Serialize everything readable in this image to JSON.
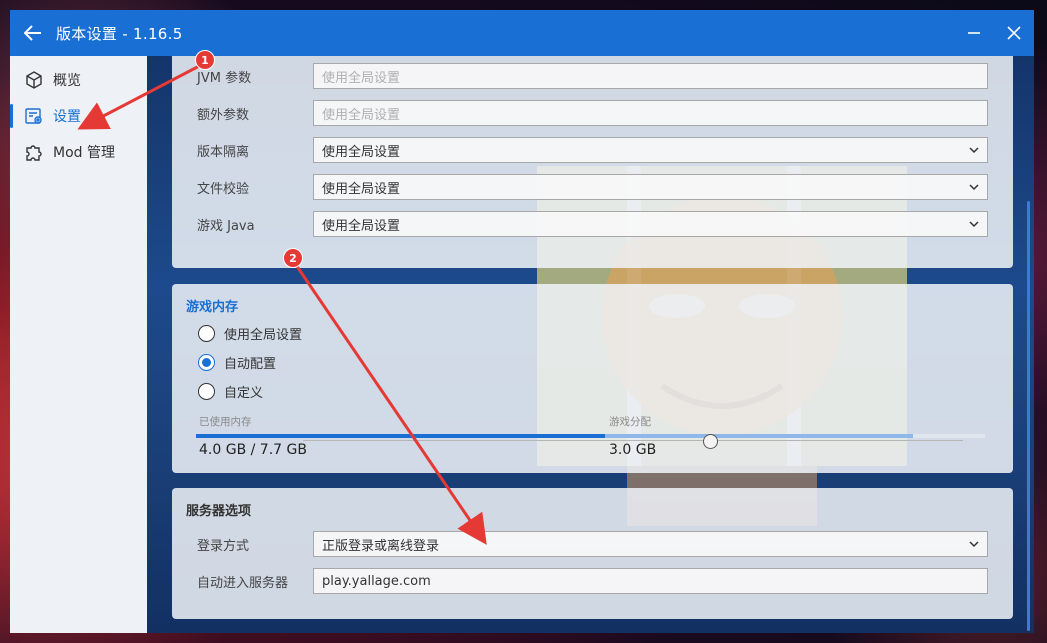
{
  "window": {
    "title": "版本设置 - 1.16.5",
    "accent": "#1a6fd4"
  },
  "sidebar": {
    "items": [
      {
        "label": "概览",
        "icon": "cube-icon",
        "active": false
      },
      {
        "label": "设置",
        "icon": "settings-doc-icon",
        "active": true
      },
      {
        "label": "Mod 管理",
        "icon": "puzzle-icon",
        "active": false
      }
    ]
  },
  "game_args": {
    "rows": [
      {
        "label": "JVM 参数",
        "value": "",
        "placeholder": "使用全局设置",
        "type": "input"
      },
      {
        "label": "额外参数",
        "value": "",
        "placeholder": "使用全局设置",
        "type": "input"
      },
      {
        "label": "版本隔离",
        "value": "使用全局设置",
        "type": "select"
      },
      {
        "label": "文件校验",
        "value": "使用全局设置",
        "type": "select"
      },
      {
        "label": "游戏 Java",
        "value": "使用全局设置",
        "type": "select"
      }
    ]
  },
  "memory": {
    "title": "游戏内存",
    "options": [
      {
        "label": "使用全局设置",
        "checked": false
      },
      {
        "label": "自动配置",
        "checked": true
      },
      {
        "label": "自定义",
        "checked": false
      }
    ],
    "slider_fraction": 0.62,
    "used_label": "已使用内存",
    "used_value": "4.0 GB / 7.7 GB",
    "alloc_label": "游戏分配",
    "alloc_value": "3.0 GB",
    "used_fraction": 0.519,
    "alloc_fraction": 0.39
  },
  "server": {
    "title": "服务器选项",
    "login_label": "登录方式",
    "login_value": "正版登录或离线登录",
    "auto_join_label": "自动进入服务器",
    "auto_join_value": "play.yallage.com"
  },
  "annotations": {
    "badge1": "1",
    "badge2": "2",
    "color": "#e53935"
  }
}
